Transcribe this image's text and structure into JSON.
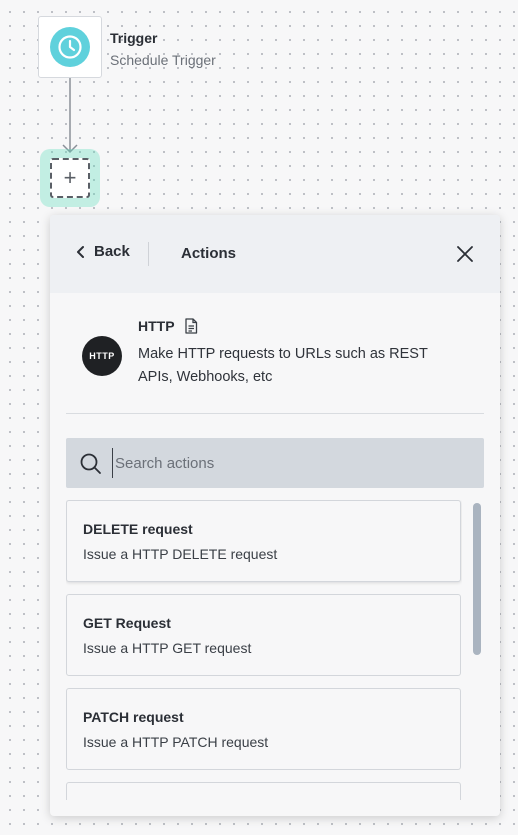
{
  "trigger": {
    "title": "Trigger",
    "subtitle": "Schedule Trigger",
    "icon": "clock-icon",
    "icon_color": "#5fd1dc"
  },
  "add_node": {
    "symbol": "+",
    "icon": "plus-icon",
    "highlight_color": "#5fdcbe"
  },
  "panel": {
    "back_label": "Back",
    "title": "Actions",
    "close_icon": "close-icon"
  },
  "app": {
    "logo_text": "HTTP",
    "name": "HTTP",
    "docs_icon": "document-icon",
    "description": "Make HTTP requests to URLs such as REST APIs, Webhooks, etc"
  },
  "search": {
    "placeholder": "Search actions",
    "value": ""
  },
  "actions": [
    {
      "title": "DELETE request",
      "description": "Issue a HTTP DELETE request"
    },
    {
      "title": "GET Request",
      "description": "Issue a HTTP GET request"
    },
    {
      "title": "PATCH request",
      "description": "Issue a HTTP PATCH request"
    },
    {
      "title": "",
      "description": ""
    }
  ]
}
